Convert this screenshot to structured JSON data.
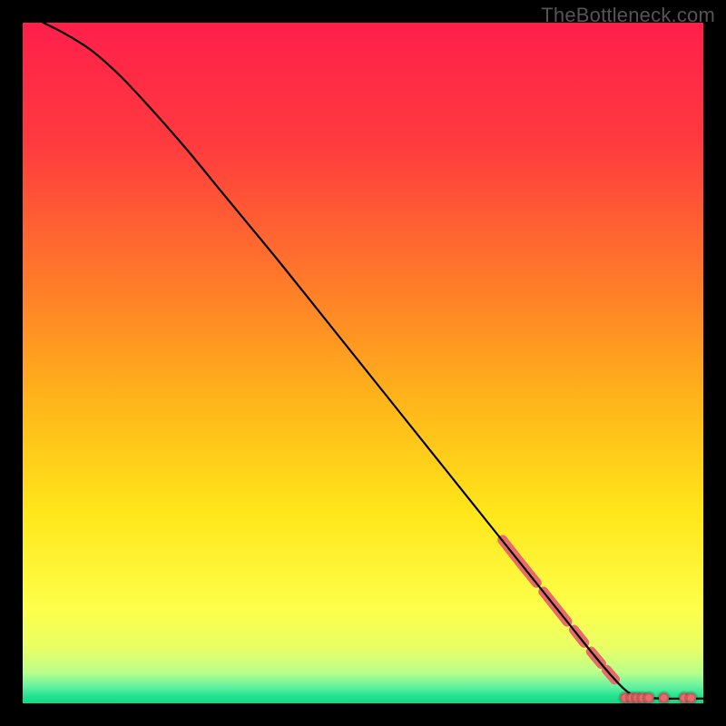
{
  "source_label": "TheBottleneck.com",
  "chart_data": {
    "type": "line",
    "title": "",
    "xlabel": "",
    "ylabel": "",
    "xlim": [
      0,
      100
    ],
    "ylim": [
      0,
      100
    ],
    "grid": false,
    "legend": false,
    "background_gradient_stops": [
      {
        "offset": 0.0,
        "color": "#ff1f4b"
      },
      {
        "offset": 0.18,
        "color": "#ff3b3e"
      },
      {
        "offset": 0.38,
        "color": "#ff7a2a"
      },
      {
        "offset": 0.55,
        "color": "#ffb31a"
      },
      {
        "offset": 0.72,
        "color": "#ffe61a"
      },
      {
        "offset": 0.86,
        "color": "#fdff4a"
      },
      {
        "offset": 0.92,
        "color": "#e8ff66"
      },
      {
        "offset": 0.955,
        "color": "#b8ff8a"
      },
      {
        "offset": 0.975,
        "color": "#66f2a0"
      },
      {
        "offset": 0.99,
        "color": "#20e28f"
      },
      {
        "offset": 1.0,
        "color": "#14d884"
      }
    ],
    "curve": [
      {
        "x": 3,
        "y": 100
      },
      {
        "x": 6,
        "y": 98.5
      },
      {
        "x": 10,
        "y": 96
      },
      {
        "x": 14,
        "y": 92.5
      },
      {
        "x": 18,
        "y": 88.3
      },
      {
        "x": 24,
        "y": 81.5
      },
      {
        "x": 30,
        "y": 74.2
      },
      {
        "x": 38,
        "y": 64.5
      },
      {
        "x": 46,
        "y": 54.5
      },
      {
        "x": 54,
        "y": 44.5
      },
      {
        "x": 62,
        "y": 34.5
      },
      {
        "x": 70,
        "y": 24.5
      },
      {
        "x": 76,
        "y": 17
      },
      {
        "x": 80,
        "y": 12
      },
      {
        "x": 84,
        "y": 7
      },
      {
        "x": 87,
        "y": 3.5
      },
      {
        "x": 89,
        "y": 1.6
      },
      {
        "x": 91,
        "y": 0.9
      },
      {
        "x": 94,
        "y": 0.7
      },
      {
        "x": 100,
        "y": 0.7
      }
    ],
    "highlight_segments": [
      {
        "x1": 70.5,
        "y1": 24.0,
        "x2": 73.0,
        "y2": 20.8
      },
      {
        "x1": 73.0,
        "y1": 20.8,
        "x2": 75.5,
        "y2": 17.7
      },
      {
        "x1": 76.5,
        "y1": 16.4,
        "x2": 78.5,
        "y2": 13.9
      },
      {
        "x1": 78.5,
        "y1": 13.9,
        "x2": 80.0,
        "y2": 12.0
      },
      {
        "x1": 81.0,
        "y1": 10.8,
        "x2": 82.5,
        "y2": 8.9
      },
      {
        "x1": 83.5,
        "y1": 7.6,
        "x2": 85.0,
        "y2": 5.8
      },
      {
        "x1": 85.8,
        "y1": 4.9,
        "x2": 87.0,
        "y2": 3.5
      }
    ],
    "highlight_points": [
      {
        "x": 88.5,
        "y": 0.8
      },
      {
        "x": 89.5,
        "y": 0.8
      },
      {
        "x": 90.3,
        "y": 0.8
      },
      {
        "x": 91.1,
        "y": 0.8
      },
      {
        "x": 92.0,
        "y": 0.8
      },
      {
        "x": 94.2,
        "y": 0.8
      },
      {
        "x": 97.2,
        "y": 0.8
      },
      {
        "x": 98.2,
        "y": 0.8
      }
    ],
    "highlight_color": "#e86a6a",
    "highlight_thickness": 11
  }
}
